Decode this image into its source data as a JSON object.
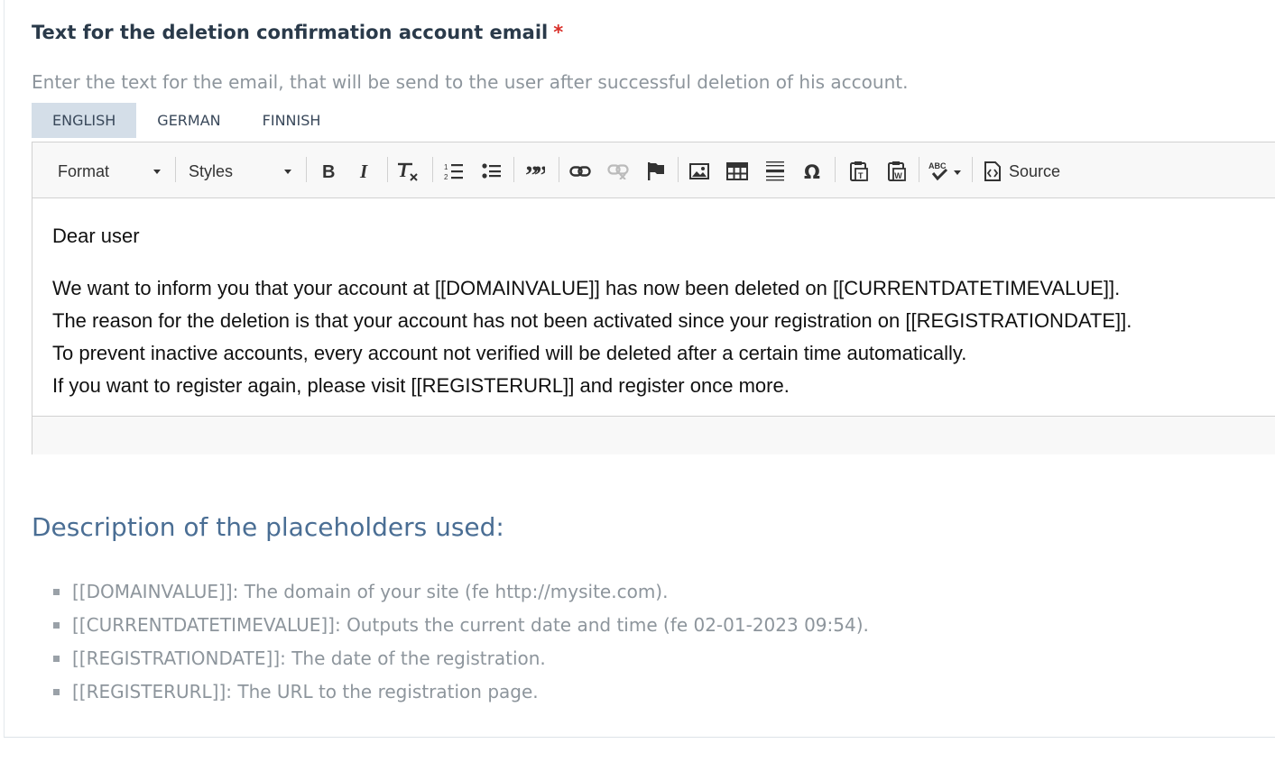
{
  "field": {
    "label": "Text for the deletion confirmation account email",
    "required_mark": "*",
    "help": "Enter the text for the email, that will be send to the user after successful deletion of his account."
  },
  "tabs": [
    {
      "label": "ENGLISH",
      "active": true
    },
    {
      "label": "GERMAN",
      "active": false
    },
    {
      "label": "FINNISH",
      "active": false
    }
  ],
  "toolbar": {
    "format_label": "Format",
    "styles_label": "Styles",
    "source_label": "Source",
    "icons": [
      "bold-icon",
      "italic-icon",
      "remove-format-icon",
      "numbered-list-icon",
      "bulleted-list-icon",
      "blockquote-icon",
      "link-icon",
      "unlink-icon",
      "anchor-icon",
      "image-icon",
      "table-icon",
      "horizontal-line-icon",
      "special-char-icon",
      "paste-text-icon",
      "paste-word-icon",
      "spellcheck-icon",
      "source-icon"
    ]
  },
  "content": {
    "greeting": "Dear user",
    "lines": [
      "We want to inform you that your account at [[DOMAINVALUE]] has now been deleted on [[CURRENTDATETIMEVALUE]].",
      "The reason for the deletion is that your account has not been activated since your registration on [[REGISTRATIONDATE]].",
      "To prevent inactive accounts, every account not verified will be deleted after a certain time automatically.",
      "If you want to register again, please visit [[REGISTERURL]] and register once more."
    ]
  },
  "placeholders": {
    "title": "Description of the placeholders used:",
    "items": [
      "[[DOMAINVALUE]]: The domain of your site (fe http://mysite.com).",
      "[[CURRENTDATETIMEVALUE]]: Outputs the current date and time (fe 02-01-2023 09:54).",
      "[[REGISTRATIONDATE]]: The date of the registration.",
      "[[REGISTERURL]]: The URL to the registration page."
    ]
  },
  "colors": {
    "label_text": "#2a3a4a",
    "required": "#d9302a",
    "help_text": "#8d959c",
    "active_tab_bg": "#d4dee8",
    "heading_blue": "#4a6e94"
  }
}
